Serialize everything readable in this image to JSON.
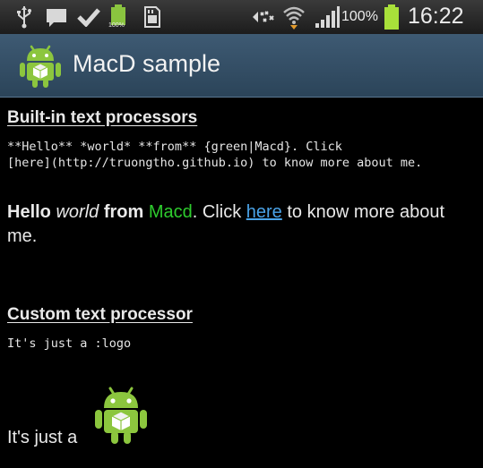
{
  "status_bar": {
    "icons": [
      "usb-icon",
      "message-icon",
      "check-icon",
      "battery-full-small-icon",
      "sd-card-icon",
      "mute-icon",
      "wifi-icon",
      "signal-icon",
      "battery-icon"
    ],
    "battery_text": "100%",
    "small_battery_text": "100%",
    "time": "16:22"
  },
  "action_bar": {
    "title": "MacD sample",
    "logo_icon": "android-logo-icon"
  },
  "builtin": {
    "header": "Built-in text processors",
    "source_line1": "**Hello** *world* **from** {green|Macd}. Click",
    "source_line2": "[here](http://truongtho.github.io) to know more about me.",
    "hello": "Hello",
    "world": "world",
    "from": "from",
    "macd": "Macd",
    "click": ". Click",
    "here": "here",
    "rest": "to know more about me."
  },
  "custom": {
    "header": "Custom text processor",
    "source": "It's just a :logo",
    "rendered": "It's just a"
  },
  "colors": {
    "action_bar": "#3e5a73",
    "green_text": "#2ecc2e",
    "link": "#4aa3e8",
    "android_green": "#8cc63e"
  }
}
